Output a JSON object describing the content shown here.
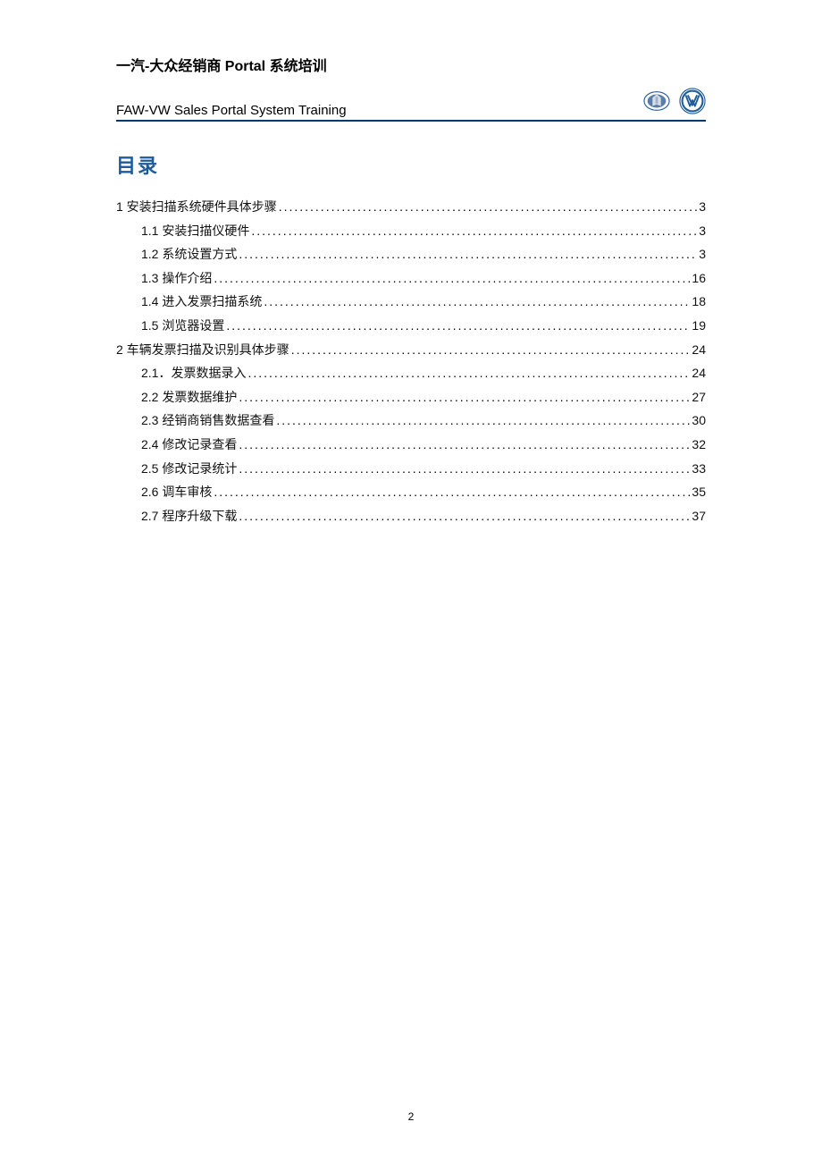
{
  "header": {
    "title_cn": "一汽-大众经销商 Portal 系统培训",
    "title_en": "FAW-VW Sales Portal System Training"
  },
  "toc_title": "目录",
  "toc": [
    {
      "level": 1,
      "label": "1 安装扫描系统硬件具体步骤",
      "page": "3"
    },
    {
      "level": 2,
      "label": "1.1 安装扫描仪硬件",
      "page": "3"
    },
    {
      "level": 2,
      "label": "1.2 系统设置方式",
      "page": "3"
    },
    {
      "level": 2,
      "label": "1.3 操作介绍",
      "page": "16"
    },
    {
      "level": 2,
      "label": "1.4 进入发票扫描系统",
      "page": "18"
    },
    {
      "level": 2,
      "label": "1.5 浏览器设置",
      "page": "19"
    },
    {
      "level": 1,
      "label": "2 车辆发票扫描及识别具体步骤",
      "page": "24"
    },
    {
      "level": 2,
      "label": "2.1．发票数据录入",
      "page": "24"
    },
    {
      "level": 2,
      "label": "2.2  发票数据维护",
      "page": "27"
    },
    {
      "level": 2,
      "label": "2.3  经销商销售数据查看",
      "page": "30"
    },
    {
      "level": 2,
      "label": "2.4  修改记录查看",
      "page": "32"
    },
    {
      "level": 2,
      "label": "2.5 修改记录统计",
      "page": "33"
    },
    {
      "level": 2,
      "label": "2.6 调车审核",
      "page": "35"
    },
    {
      "level": 2,
      "label": "2.7 程序升级下载",
      "page": "37"
    }
  ],
  "page_number": "2"
}
